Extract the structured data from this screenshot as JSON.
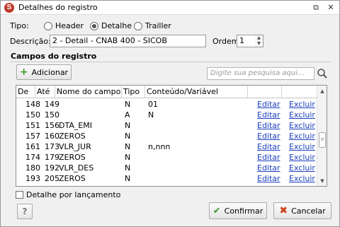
{
  "window": {
    "title": "Detalhes do registro",
    "icon_letter": "S",
    "restore_glyph": "⧉",
    "close_glyph": "✕"
  },
  "tipo": {
    "label": "Tipo:",
    "options": [
      {
        "label": "Header",
        "selected": false
      },
      {
        "label": "Detalhe",
        "selected": true
      },
      {
        "label": "Trailler",
        "selected": false
      }
    ]
  },
  "descricao": {
    "label": "Descrição:",
    "value": "2 - Detail - CNAB 400 - SICOB"
  },
  "ordem": {
    "label": "Ordem:",
    "value": "1",
    "spin_up": "▲",
    "spin_down": "▼"
  },
  "campos": {
    "section_title": "Campos do registro",
    "add_button": "Adicionar",
    "search_placeholder": "Digite sua pesquisa aqui...",
    "columns": [
      "De",
      "Até",
      "Nome do campo",
      "Tipo",
      "Conteúdo/Variável"
    ],
    "rows": [
      {
        "de": "148",
        "ate": "149",
        "nome": "",
        "tipo": "N",
        "conteudo": "01",
        "edit": "Editar",
        "delete": "Excluir"
      },
      {
        "de": "150",
        "ate": "150",
        "nome": "",
        "tipo": "A",
        "conteudo": "N",
        "edit": "Editar",
        "delete": "Excluir"
      },
      {
        "de": "151",
        "ate": "156",
        "nome": "DTA_EMI",
        "tipo": "N",
        "conteudo": "",
        "edit": "Editar",
        "delete": "Excluir"
      },
      {
        "de": "157",
        "ate": "160",
        "nome": "ZEROS",
        "tipo": "N",
        "conteudo": "",
        "edit": "Editar",
        "delete": "Excluir"
      },
      {
        "de": "161",
        "ate": "173",
        "nome": "VLR_JUR",
        "tipo": "N",
        "conteudo": "n,nnn",
        "edit": "Editar",
        "delete": "Excluir"
      },
      {
        "de": "174",
        "ate": "179",
        "nome": "ZEROS",
        "tipo": "N",
        "conteudo": "",
        "edit": "Editar",
        "delete": "Excluir"
      },
      {
        "de": "180",
        "ate": "192",
        "nome": "VLR_DES",
        "tipo": "N",
        "conteudo": "",
        "edit": "Editar",
        "delete": "Excluir"
      },
      {
        "de": "193",
        "ate": "205",
        "nome": "ZEROS",
        "tipo": "N",
        "conteudo": "",
        "edit": "Editar",
        "delete": "Excluir"
      }
    ]
  },
  "detalhe_por_lancamento": {
    "label": "Detalhe por lançamento",
    "checked": false
  },
  "footer": {
    "help_label": "?",
    "confirm_label": "Confirmar",
    "confirm_glyph": "✔",
    "cancel_label": "Cancelar",
    "cancel_glyph": "✖"
  },
  "colors": {
    "link": "#1a3fbf",
    "add_icon": "#3a9a2a",
    "cancel_icon": "#d0451b",
    "app_icon": "#c0392b"
  }
}
